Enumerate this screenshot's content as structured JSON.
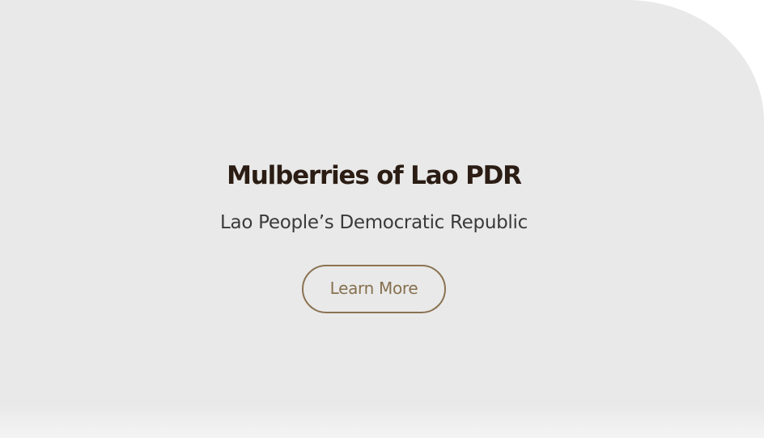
{
  "hero": {
    "title": "Mulberries of Lao PDR",
    "subtitle": "Lao People’s Democratic Republic",
    "button_label": "Learn More"
  },
  "colors": {
    "background": "#e9e9e9",
    "title": "#2b1d14",
    "subtitle": "#3a3a3a",
    "accent": "#86704f"
  }
}
